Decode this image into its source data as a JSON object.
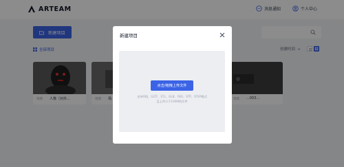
{
  "header": {
    "logo_text": "ARTEAM",
    "messages_label": "消息通知",
    "profile_label": "个人中心"
  },
  "toolbar": {
    "new_project_label": "新建项目",
    "all_projects_label": "全部项目",
    "sort_label": "创建时间"
  },
  "cards": [
    {
      "tag": "场景",
      "title": "人像（对外..."
    },
    {
      "tag": "场景",
      "title": "场..."
    },
    {
      "tag": "场景",
      "title": "...003..."
    }
  ],
  "modal": {
    "title": "新建项目",
    "upload_button": "点击/拖拽上传文件",
    "hint_formats": "支持OBJ、GLTF、STL、GLB、FBX、STP、STEP格式",
    "hint_size": "且上传小于100M的文件"
  },
  "colors": {
    "accent": "#3b63e6",
    "overlay": "rgba(0,0,0,0.45)",
    "dropzone": "#eceef2"
  }
}
